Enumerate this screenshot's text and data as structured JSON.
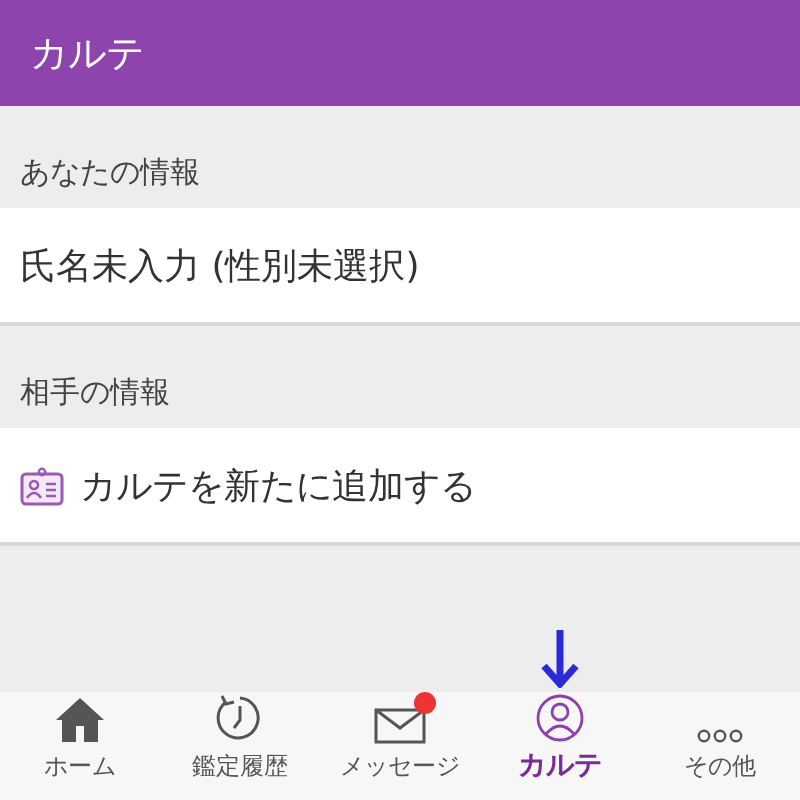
{
  "header": {
    "title": "カルテ"
  },
  "sections": [
    {
      "label": "あなたの情報",
      "row": {
        "text": "氏名未入力 (性別未選択)",
        "icon": false
      }
    },
    {
      "label": "相手の情報",
      "row": {
        "text": "カルテを新たに追加する",
        "icon": true
      }
    }
  ],
  "tabs": [
    {
      "kind": "home",
      "label": "ホーム",
      "selected": false,
      "badge": false
    },
    {
      "kind": "history",
      "label": "鑑定履歴",
      "selected": false,
      "badge": false
    },
    {
      "kind": "message",
      "label": "メッセージ",
      "selected": false,
      "badge": true
    },
    {
      "kind": "karte",
      "label": "カルテ",
      "selected": true,
      "badge": false
    },
    {
      "kind": "more",
      "label": "その他",
      "selected": false,
      "badge": false
    }
  ]
}
